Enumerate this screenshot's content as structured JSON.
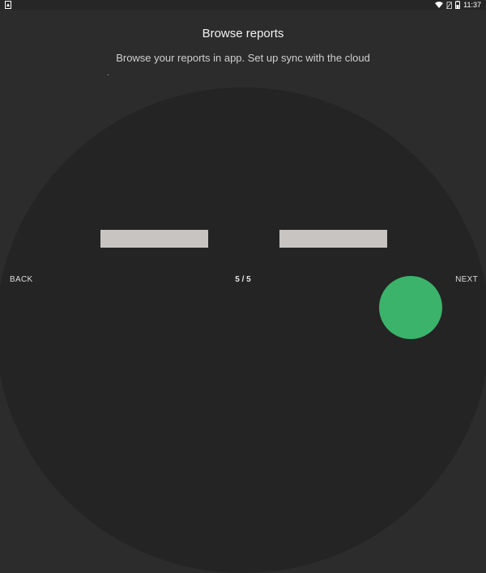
{
  "statusbar": {
    "time": "11:37",
    "icons": [
      "notification-icon",
      "wifi-icon",
      "no-sim-icon",
      "battery-icon"
    ]
  },
  "onboarding": {
    "title": "Browse reports",
    "subtitle": "Browse your reports in app. Set up sync with the cloud",
    "page_indicator": "5 / 5"
  },
  "nav": {
    "back_label": "BACK",
    "next_label": "NEXT"
  },
  "colors": {
    "background": "#2c2c2c",
    "arc": "#242424",
    "accent": "#3bb36b",
    "bar": "#c8c4c2"
  }
}
